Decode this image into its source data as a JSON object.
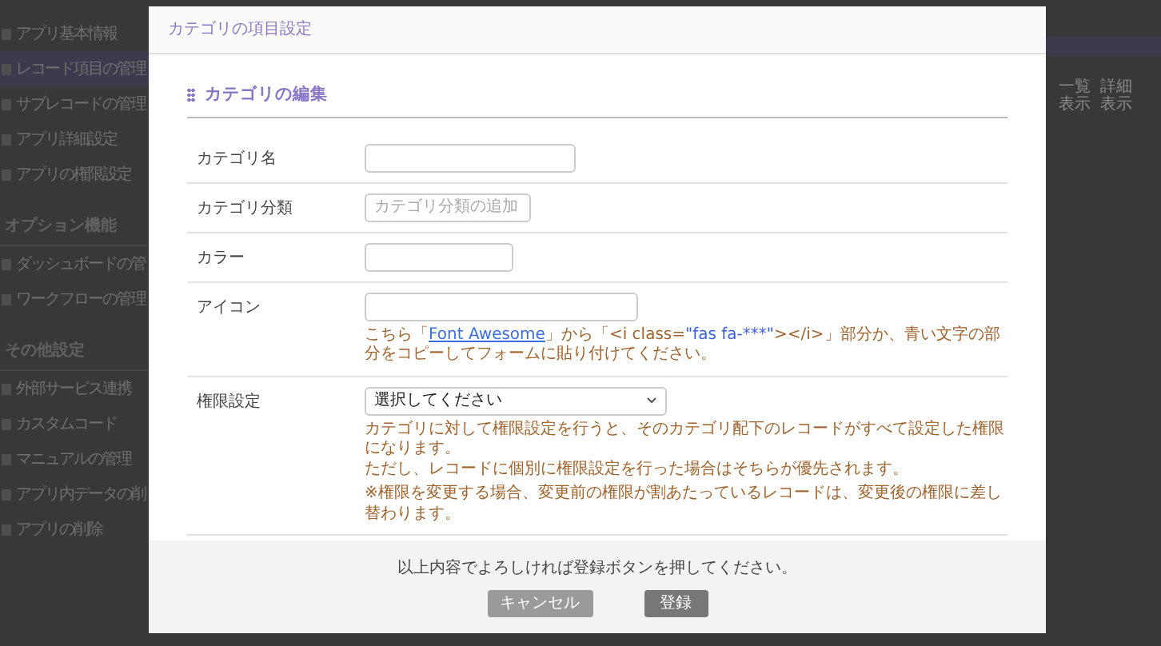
{
  "sidebar": {
    "items": [
      {
        "kind": "item",
        "label": "アプリ基本情報",
        "selected": false
      },
      {
        "kind": "item",
        "label": "レコード項目の管理",
        "selected": true
      },
      {
        "kind": "item",
        "label": "サブレコードの管理",
        "selected": false
      },
      {
        "kind": "item",
        "label": "アプリ詳細設定",
        "selected": false
      },
      {
        "kind": "item",
        "label": "アプリの権限設定",
        "selected": false
      },
      {
        "kind": "heading",
        "label": "オプション機能"
      },
      {
        "kind": "item",
        "label": "ダッシュボードの管",
        "selected": false
      },
      {
        "kind": "item",
        "label": "ワークフローの管理",
        "selected": false
      },
      {
        "kind": "heading",
        "label": "その他設定"
      },
      {
        "kind": "item",
        "label": "外部サービス連携",
        "selected": false
      },
      {
        "kind": "item",
        "label": "カスタムコード",
        "selected": false
      },
      {
        "kind": "item",
        "label": "マニュアルの管理",
        "selected": false
      },
      {
        "kind": "item",
        "label": "アプリ内データの削",
        "selected": false
      },
      {
        "kind": "item",
        "label": "アプリの削除",
        "selected": false
      }
    ]
  },
  "table": {
    "columns": [
      "一覧表示",
      "詳細表示"
    ]
  },
  "modal": {
    "title": "カテゴリの項目設定",
    "section_title": "カテゴリの編集",
    "fields": [
      {
        "kind": "text",
        "label": "カテゴリ名"
      },
      {
        "kind": "text",
        "label": "カテゴリ分類",
        "placeholder": "カテゴリ分類の追加"
      },
      {
        "kind": "text",
        "label": "カラー"
      },
      {
        "kind": "text",
        "label": "アイコン",
        "help": [
          {
            "kind": "text",
            "text": "こちら「"
          },
          {
            "kind": "link",
            "text": "Font Awesome"
          },
          {
            "kind": "text",
            "text": "」から「<i class="
          },
          {
            "kind": "code",
            "text": "\"fas fa-***\""
          },
          {
            "kind": "text",
            "text": "></i>」部分か、青い文字の部分をコピーしてフォームに貼り付けてください。"
          }
        ]
      },
      {
        "kind": "select",
        "label": "権限設定",
        "value": "選択してください",
        "notes": [
          "カテゴリに対して権限設定を行うと、そのカテゴリ配下のレコードがすべて設定した権限になります。",
          "ただし、レコードに個別に権限設定を行った場合はそちらが優先されます。",
          "※権限を変更する場合、変更前の権限が割あたっているレコードは、変更後の権限に差し替わります。"
        ]
      }
    ],
    "footer_message": "以上内容でよろしければ登録ボタンを押してください。",
    "buttons": [
      {
        "kind": "cancel",
        "label": "キャンセル"
      },
      {
        "kind": "submit",
        "label": "登録"
      }
    ]
  }
}
